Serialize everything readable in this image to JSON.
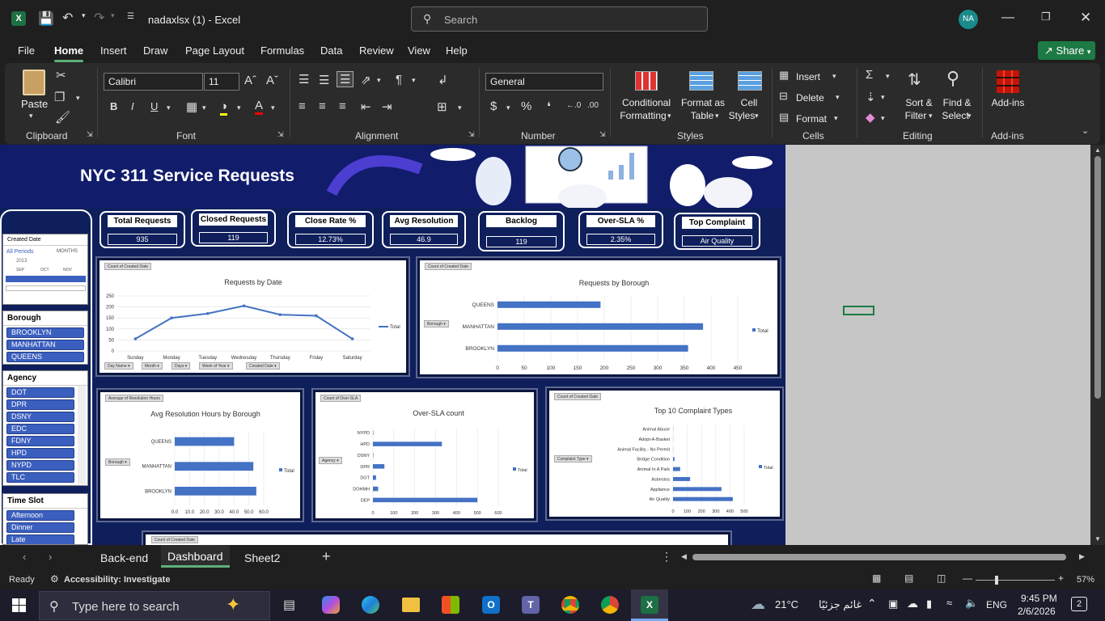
{
  "window": {
    "title": "nadaxlsx  (1)  -  Excel",
    "search_placeholder": "Search",
    "user_initials": "NA"
  },
  "menu": [
    "File",
    "Home",
    "Insert",
    "Draw",
    "Page Layout",
    "Formulas",
    "Data",
    "Review",
    "View",
    "Help"
  ],
  "share_label": "Share",
  "ribbon": {
    "paste": "Paste",
    "font_name": "Calibri",
    "font_size": "11",
    "number_format": "General",
    "conditional": "Conditional",
    "formatting": "Formatting",
    "format_as": "Format as",
    "table": "Table",
    "cell": "Cell",
    "styles_btn": "Styles",
    "insert": "Insert",
    "delete": "Delete",
    "format": "Format",
    "sort": "Sort &",
    "filter": "Filter",
    "find": "Find &",
    "select": "Select",
    "addins": "Add-ins",
    "groups": {
      "clipboard": "Clipboard",
      "font": "Font",
      "alignment": "Alignment",
      "number": "Number",
      "styles": "Styles",
      "cells": "Cells",
      "editing": "Editing",
      "addins": "Add-ins"
    }
  },
  "dashboard": {
    "title": "NYC 311 Service Requests",
    "kpis": [
      {
        "label": "Total Requests",
        "value": "935"
      },
      {
        "label": "Closed Requests",
        "value": "119"
      },
      {
        "label": "Close Rate %",
        "value": "12.73%"
      },
      {
        "label": "Avg Resolution",
        "value": "46.9"
      },
      {
        "label": "Backlog",
        "value": "119"
      },
      {
        "label": "Over-SLA %",
        "value": "2.35%"
      },
      {
        "label": "Top Complaint",
        "value": "Air Quality"
      }
    ],
    "timeline": {
      "header": "Created Date",
      "all_periods": "All Periods",
      "unit": "MONTHS",
      "year": "2013",
      "months": [
        "SEP",
        "OCT",
        "NOV"
      ]
    },
    "borough_slicer": {
      "header": "Borough",
      "items": [
        "BROOKLYN",
        "MANHATTAN",
        "QUEENS"
      ]
    },
    "agency_slicer": {
      "header": "Agency",
      "items": [
        "DOT",
        "DPR",
        "DSNY",
        "EDC",
        "FDNY",
        "HPD",
        "NYPD",
        "TLC"
      ]
    },
    "timeslot_slicer": {
      "header": "Time Slot",
      "items": [
        "Afternoon",
        "Dinner",
        "Late"
      ]
    }
  },
  "chart_data": [
    {
      "type": "line",
      "title": "Requests by Date",
      "field_button": "Count of Created Date",
      "categories": [
        "Sunday",
        "Monday",
        "Tuesday",
        "Wednesday",
        "Thursday",
        "Friday",
        "Saturday"
      ],
      "series": [
        {
          "name": "Total",
          "values": [
            55,
            150,
            170,
            205,
            165,
            160,
            55
          ]
        }
      ],
      "ylim": [
        0,
        250
      ],
      "yticks": [
        0,
        50,
        100,
        150,
        200,
        250
      ],
      "axis_buttons": [
        "Day Name",
        "Month",
        "Days",
        "Week of Year",
        "Created Date"
      ]
    },
    {
      "type": "bar",
      "title": "Requests by Borough",
      "field_button": "Count of Created Date",
      "axis_button": "Borough",
      "categories": [
        "QUEENS",
        "MANHATTAN",
        "BROOKLYN"
      ],
      "series": [
        {
          "name": "Total",
          "values": [
            193,
            385,
            357
          ]
        }
      ],
      "xlim": [
        0,
        450
      ],
      "xticks": [
        0,
        50,
        100,
        150,
        200,
        250,
        300,
        350,
        400,
        450
      ]
    },
    {
      "type": "bar",
      "title": "Avg Resolution Hours by Borough",
      "field_button": "Average of Resolution Hours",
      "axis_button": "Borough",
      "categories": [
        "QUEENS",
        "MANHATTAN",
        "BROOKLYN"
      ],
      "series": [
        {
          "name": "Total",
          "values": [
            40,
            53,
            55
          ]
        }
      ],
      "xlim": [
        0,
        60
      ],
      "xticks": [
        "0.0",
        "10.0",
        "20.0",
        "30.0",
        "40.0",
        "50.0",
        "60.0"
      ]
    },
    {
      "type": "bar",
      "title": "Over-SLA count",
      "field_button": "Count of Over-SLA",
      "axis_button": "Agency",
      "categories": [
        "NYPD",
        "HPD",
        "DSNY",
        "DPR",
        "DOT",
        "DOHMH",
        "DEP"
      ],
      "series": [
        {
          "name": "Total",
          "values": [
            2,
            330,
            2,
            55,
            15,
            25,
            500
          ]
        }
      ],
      "xlim": [
        0,
        600
      ],
      "xticks": [
        0,
        100,
        200,
        300,
        400,
        500,
        600
      ]
    },
    {
      "type": "bar",
      "title": "Top 10 Complaint Types",
      "field_button": "Count of Created Date",
      "axis_button": "Complaint Type",
      "categories": [
        "Animal Abuse",
        "Adopt-A-Basket",
        "Animal Facility - No Permit",
        "Bridge Condition",
        "Animal In A Park",
        "Asbestos",
        "Appliance",
        "Air Quality"
      ],
      "series": [
        {
          "name": "Total",
          "values": [
            1,
            1,
            1,
            10,
            50,
            120,
            340,
            420
          ]
        }
      ],
      "xlim": [
        0,
        500
      ],
      "xticks": [
        0,
        100,
        200,
        300,
        400,
        500
      ]
    }
  ],
  "bottom_chart_button": "Count of Created Date",
  "sheets": [
    "Back-end",
    "Dashboard",
    "Sheet2"
  ],
  "status": {
    "ready": "Ready",
    "accessibility": "Accessibility: Investigate",
    "zoom": "57%"
  },
  "taskbar": {
    "search_placeholder": "Type here to search",
    "weather": "21°C",
    "weather_text": "غائم جزئيًا",
    "lang": "ENG",
    "time": "9:45 PM",
    "date": "2/6/2026",
    "notif_count": "2"
  },
  "colors": {
    "bar": "#4472c4",
    "dashboard_bg": "#0f1f5c",
    "excel_green": "#5fb07a"
  }
}
